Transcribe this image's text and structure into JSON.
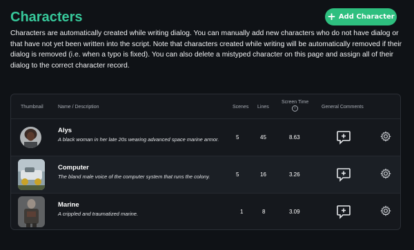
{
  "header": {
    "title": "Characters",
    "add_button_label": "Add Character",
    "description": "Characters are automatically created while writing dialog. You can manually add new characters who do not have dialog or that have not yet been written into the script. Note that characters created while writing will be automatically removed if their dialog is removed (i.e. when a typo is fixed). You can also delete a mistyped character on this page and assign all of their dialog to the correct character record."
  },
  "table": {
    "columns": {
      "thumbnail": "Thumbnail",
      "name": "Name / Description",
      "scenes": "Scenes",
      "lines": "Lines",
      "screen_time": "Screen Time",
      "comments": "General Comments"
    },
    "rows": [
      {
        "name": "Alys",
        "description": "A black woman in her late 20s wearing advanced space marine armor.",
        "scenes": "5",
        "lines": "45",
        "screen_time": "8.63",
        "thumbnail_icon": "alys-portrait"
      },
      {
        "name": "Computer",
        "description": "The bland male voice of the computer system that runs the colony.",
        "scenes": "5",
        "lines": "16",
        "screen_time": "3.26",
        "thumbnail_icon": "computer-vehicle-image"
      },
      {
        "name": "Marine",
        "description": "A crippled and traumatized marine.",
        "scenes": "1",
        "lines": "8",
        "screen_time": "3.09",
        "thumbnail_icon": "marine-figure-image"
      }
    ]
  },
  "colors": {
    "accent_title": "#37c99b",
    "button_bg": "#2ebf7f",
    "background": "#0f1216"
  }
}
